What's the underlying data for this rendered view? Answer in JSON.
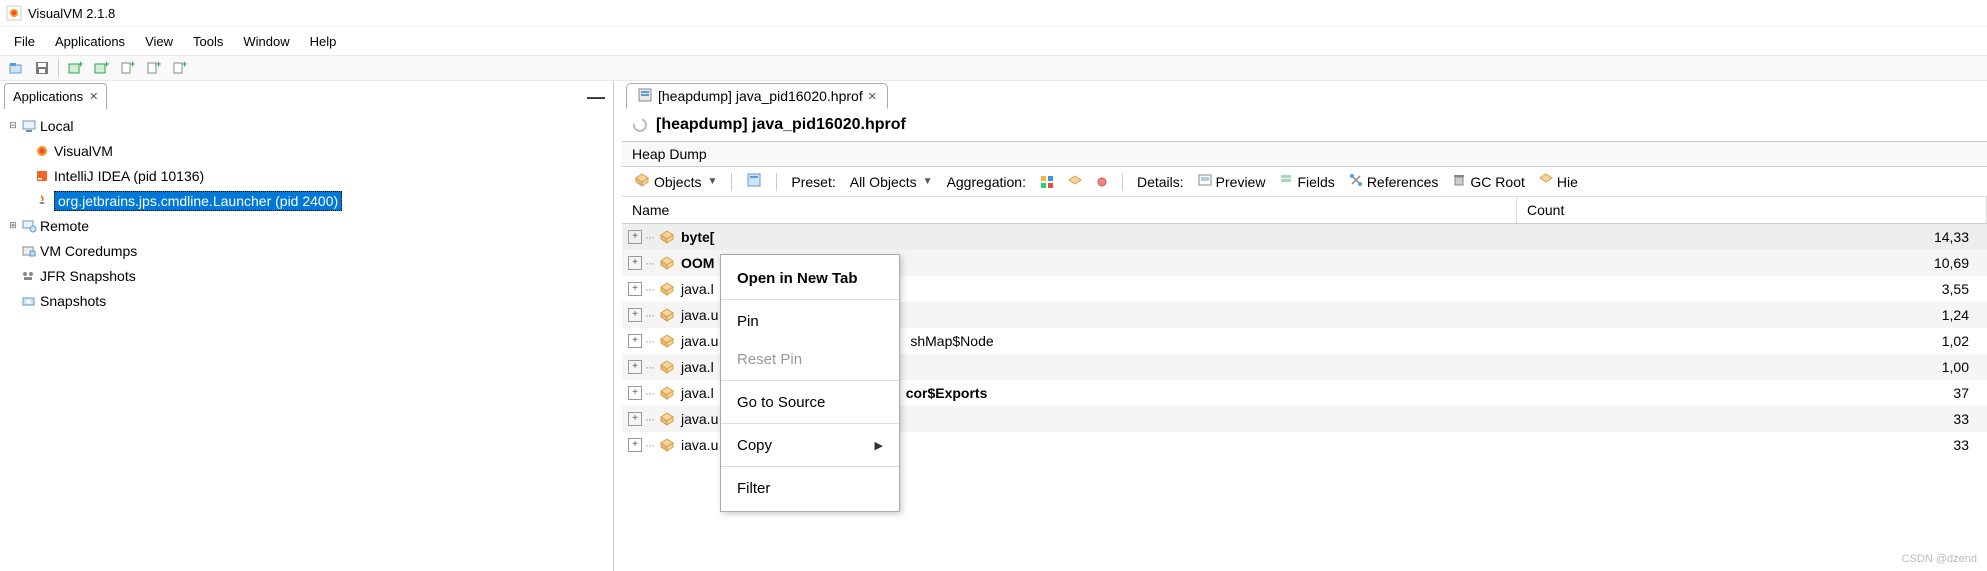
{
  "app": {
    "title": "VisualVM 2.1.8"
  },
  "menubar": [
    "File",
    "Applications",
    "View",
    "Tools",
    "Window",
    "Help"
  ],
  "left": {
    "tab": "Applications",
    "tree": {
      "local": "Local",
      "items": [
        "VisualVM",
        "IntelliJ IDEA (pid 10136)",
        "org.jetbrains.jps.cmdline.Launcher (pid 2400)"
      ],
      "remote": "Remote",
      "coredumps": "VM Coredumps",
      "jfr": "JFR Snapshots",
      "snapshots": "Snapshots"
    }
  },
  "right": {
    "tab": "[heapdump] java_pid16020.hprof",
    "header": "[heapdump] java_pid16020.hprof",
    "section": "Heap Dump",
    "toolbar": {
      "objects": "Objects",
      "preset_label": "Preset:",
      "preset_value": "All Objects",
      "aggregation": "Aggregation:",
      "details": "Details:",
      "preview": "Preview",
      "fields": "Fields",
      "references": "References",
      "gcroot": "GC Root",
      "hier": "Hie"
    },
    "columns": {
      "name": "Name",
      "count": "Count"
    },
    "rows": [
      {
        "name": "byte[",
        "count": "14,33",
        "bold": true
      },
      {
        "name": "OOM",
        "count": "10,69",
        "bold": true
      },
      {
        "name": "java.l",
        "count": "3,55"
      },
      {
        "name": "java.u",
        "count": "1,24"
      },
      {
        "name": "java.u",
        "after": "shMap$Node",
        "count": "1,02"
      },
      {
        "name": "java.l",
        "count": "1,00"
      },
      {
        "name": "java.l",
        "after": "cor$Exports",
        "count": "37",
        "bold_after": true
      },
      {
        "name": "java.u",
        "count": "33"
      },
      {
        "name": "iava.u",
        "count": "33"
      }
    ]
  },
  "context_menu": {
    "open": "Open in New Tab",
    "pin": "Pin",
    "reset": "Reset Pin",
    "goto": "Go to Source",
    "copy": "Copy",
    "filter": "Filter"
  },
  "watermark": "CSDN @dzend"
}
